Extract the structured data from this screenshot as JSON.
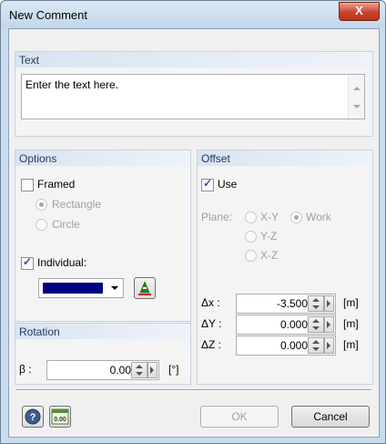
{
  "window": {
    "title": "New Comment",
    "close_label": "X"
  },
  "text_group": {
    "title": "Text",
    "value": "Enter the text here."
  },
  "options": {
    "title": "Options",
    "framed_label": "Framed",
    "framed_checked": false,
    "rectangle_label": "Rectangle",
    "circle_label": "Circle",
    "individual_label": "Individual:",
    "individual_checked": true,
    "color": "#000080"
  },
  "rotation": {
    "title": "Rotation",
    "beta_label": "β :",
    "beta_value": "0.00",
    "unit": "[°]"
  },
  "offset": {
    "title": "Offset",
    "use_label": "Use",
    "use_checked": true,
    "plane_label": "Plane:",
    "xy_label": "X-Y",
    "work_label": "Work",
    "yz_label": "Y-Z",
    "xz_label": "X-Z",
    "dx_label": "Δx :",
    "dx_value": "-3.500",
    "dx_unit": "[m]",
    "dy_label": "ΔY :",
    "dy_value": "0.000",
    "dy_unit": "[m]",
    "dz_label": "ΔZ :",
    "dz_value": "0.000",
    "dz_unit": "[m]"
  },
  "footer": {
    "units_icon_text": "0.00",
    "ok_label": "OK",
    "cancel_label": "Cancel"
  }
}
